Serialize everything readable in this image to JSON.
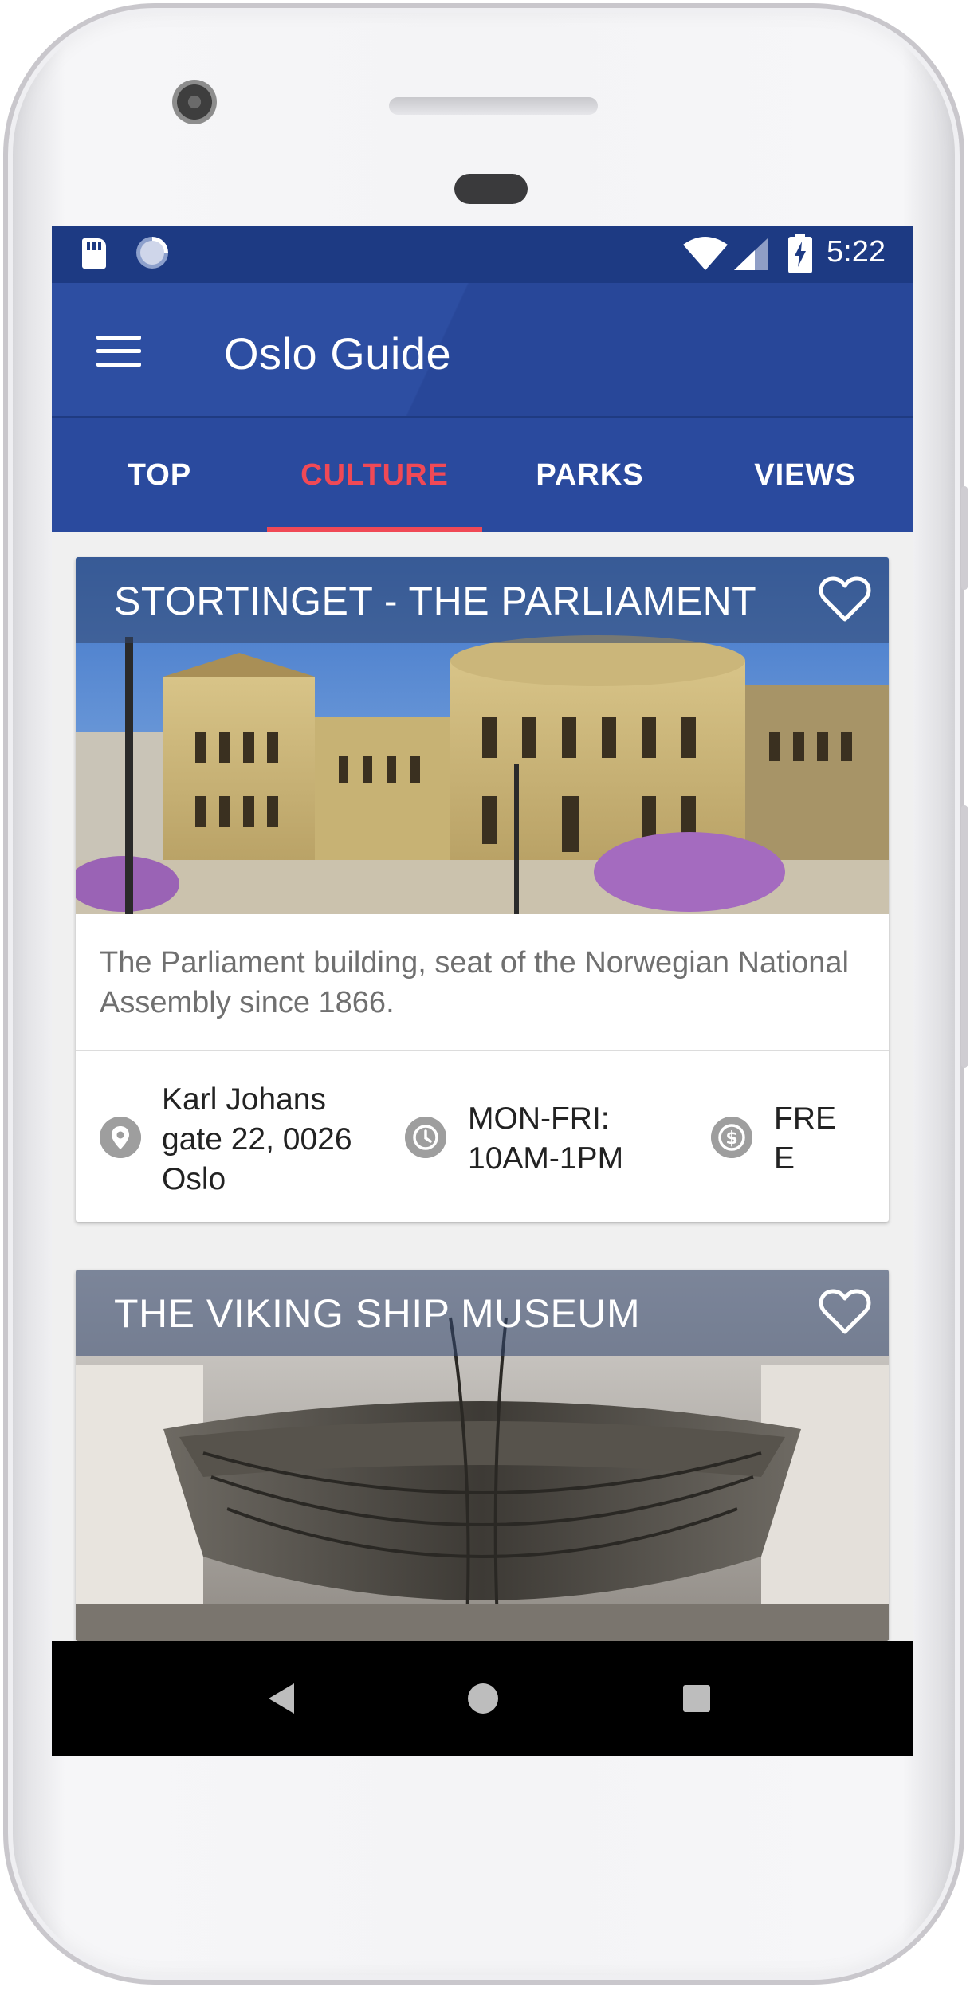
{
  "status_bar": {
    "time": "5:22",
    "icons": [
      "sd-card-icon",
      "sync-icon",
      "wifi-icon",
      "signal-icon",
      "battery-charging-icon"
    ]
  },
  "app_bar": {
    "title": "Oslo Guide",
    "menu_icon": "hamburger-menu-icon"
  },
  "tabs": [
    {
      "label": "TOP",
      "active": false
    },
    {
      "label": "CULTURE",
      "active": true
    },
    {
      "label": "PARKS",
      "active": false
    },
    {
      "label": "VIEWS",
      "active": false
    }
  ],
  "cards": [
    {
      "title": "STORTINGET - THE PARLIAMENT",
      "description": "The Parliament building, seat of the Norwegian National Assembly since 1866.",
      "address_lines": [
        "Karl Johans",
        "gate 22, 0026",
        "Oslo"
      ],
      "hours_lines": [
        "MON-FRI:",
        "10AM-1PM"
      ],
      "price_lines": [
        "FRE",
        "E"
      ],
      "favorite_icon": "heart-outline-icon"
    },
    {
      "title": "THE VIKING SHIP MUSEUM",
      "favorite_icon": "heart-outline-icon"
    }
  ],
  "nav_bar": {
    "icons": [
      "back-icon",
      "home-icon",
      "recent-apps-icon"
    ]
  },
  "colors": {
    "status_bar": "#1d3a83",
    "app_bar": "#2d4ea2",
    "tab_active": "#f04956",
    "tab_text": "#ffffff",
    "background": "#f0f0f0",
    "nav_bar": "#000000"
  }
}
